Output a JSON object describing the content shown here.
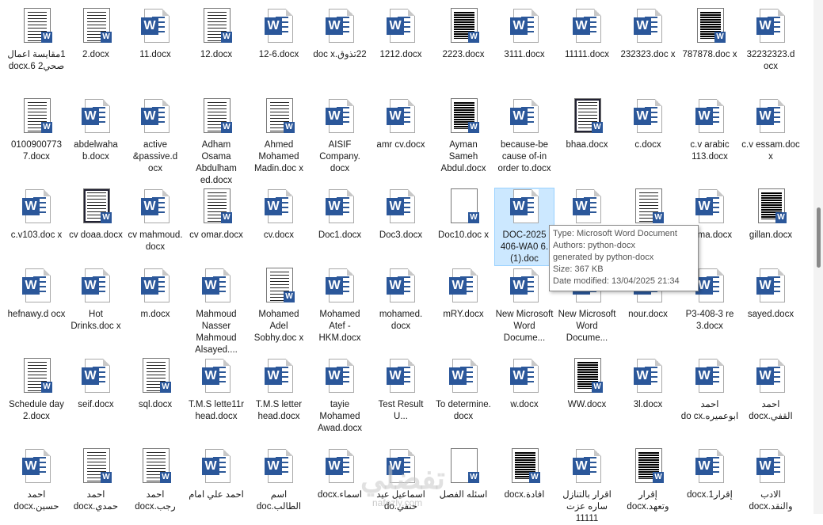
{
  "items": [
    {
      "label": "1مقايسة اعمال صحي2 6.docx",
      "kind": "thumb"
    },
    {
      "label": "2.docx",
      "kind": "thumb"
    },
    {
      "label": "11.docx",
      "kind": "word"
    },
    {
      "label": "12.docx",
      "kind": "thumb"
    },
    {
      "label": "12-6.docx",
      "kind": "word"
    },
    {
      "label": "22تذوق.doc x",
      "kind": "word"
    },
    {
      "label": "1212.docx",
      "kind": "word"
    },
    {
      "label": "2223.docx",
      "kind": "thumb-dark"
    },
    {
      "label": "3111.docx",
      "kind": "word"
    },
    {
      "label": "11111.docx",
      "kind": "word"
    },
    {
      "label": "232323.doc x",
      "kind": "word"
    },
    {
      "label": "787878.doc x",
      "kind": "thumb-dark"
    },
    {
      "label": "32232323.d ocx",
      "kind": "word"
    },
    {
      "label": "0100900773 7.docx",
      "kind": "thumb"
    },
    {
      "label": "abdelwaha b.docx",
      "kind": "word"
    },
    {
      "label": "active &passive.d ocx",
      "kind": "word"
    },
    {
      "label": "Adham Osama Abdulham ed.docx",
      "kind": "thumb"
    },
    {
      "label": "Ahmed Mohamed Madin.doc x",
      "kind": "thumb"
    },
    {
      "label": "AISIF Company. docx",
      "kind": "word"
    },
    {
      "label": "amr cv.docx",
      "kind": "word"
    },
    {
      "label": "Ayman Sameh Abdul.docx",
      "kind": "thumb-dark"
    },
    {
      "label": "because-be cause of-in order to.docx",
      "kind": "word"
    },
    {
      "label": "bhaa.docx",
      "kind": "thumb-border"
    },
    {
      "label": "c.docx",
      "kind": "word"
    },
    {
      "label": "c.v arabic 113.docx",
      "kind": "word"
    },
    {
      "label": "c.v essam.doc x",
      "kind": "word"
    },
    {
      "label": "c.v103.doc x",
      "kind": "word"
    },
    {
      "label": "cv doaa.docx",
      "kind": "thumb-border"
    },
    {
      "label": "cv mahmoud. docx",
      "kind": "word"
    },
    {
      "label": "cv omar.docx",
      "kind": "thumb"
    },
    {
      "label": "cv.docx",
      "kind": "word"
    },
    {
      "label": "Doc1.docx",
      "kind": "word"
    },
    {
      "label": "Doc3.docx",
      "kind": "word"
    },
    {
      "label": "Doc10.doc x",
      "kind": "thumb-blank"
    },
    {
      "label": "DOC-2025 406-WA0 6.(1).doc",
      "kind": "selected"
    },
    {
      "label": "",
      "kind": "word"
    },
    {
      "label": "",
      "kind": "thumb"
    },
    {
      "label": "fatma.docx",
      "kind": "word"
    },
    {
      "label": "gillan.docx",
      "kind": "thumb-dark"
    },
    {
      "label": "hefnawy.d ocx",
      "kind": "word"
    },
    {
      "label": "Hot Drinks.doc x",
      "kind": "word"
    },
    {
      "label": "m.docx",
      "kind": "word"
    },
    {
      "label": "Mahmoud Nasser Mahmoud Alsayed....",
      "kind": "word"
    },
    {
      "label": "Mohamed Adel Sobhy.doc x",
      "kind": "thumb"
    },
    {
      "label": "Mohamed Atef - HKM.docx",
      "kind": "word"
    },
    {
      "label": "mohamed. docx",
      "kind": "word"
    },
    {
      "label": "mRY.docx",
      "kind": "word"
    },
    {
      "label": "New Microsoft Word Docume...",
      "kind": "word"
    },
    {
      "label": "New Microsoft Word Docume...",
      "kind": "word"
    },
    {
      "label": "nour.docx",
      "kind": "word"
    },
    {
      "label": "P3-408-3 re 3.docx",
      "kind": "word"
    },
    {
      "label": "sayed.docx",
      "kind": "word"
    },
    {
      "label": "Schedule day 2.docx",
      "kind": "thumb"
    },
    {
      "label": "seif.docx",
      "kind": "word"
    },
    {
      "label": "sql.docx",
      "kind": "thumb"
    },
    {
      "label": "T.M.S lette11r head.docx",
      "kind": "word"
    },
    {
      "label": "T.M.S letter head.docx",
      "kind": "word"
    },
    {
      "label": "tayie Mohamed Awad.docx",
      "kind": "word"
    },
    {
      "label": "Test Result U...",
      "kind": "word"
    },
    {
      "label": "To determine. docx",
      "kind": "word"
    },
    {
      "label": "w.docx",
      "kind": "word"
    },
    {
      "label": "WW.docx",
      "kind": "thumb-dark"
    },
    {
      "label": "3l.docx",
      "kind": "word"
    },
    {
      "label": "احمد ابوعميره.do cx",
      "kind": "word"
    },
    {
      "label": "احمد القفي.docx",
      "kind": "word"
    },
    {
      "label": "احمد حسين.docx",
      "kind": "word"
    },
    {
      "label": "احمد حمدي.docx",
      "kind": "thumb"
    },
    {
      "label": "احمد رجب.docx",
      "kind": "thumb"
    },
    {
      "label": "احمد علي امام",
      "kind": "word"
    },
    {
      "label": "اسم الطالب.doc",
      "kind": "word"
    },
    {
      "label": "اسماء.docx",
      "kind": "word"
    },
    {
      "label": "اسماعيل عيد حنفي.do",
      "kind": "word"
    },
    {
      "label": "اسئله الفصل",
      "kind": "thumb-blank"
    },
    {
      "label": "افادة.docx",
      "kind": "thumb-dark"
    },
    {
      "label": "اقرار بالتنازل ساره عزت 11111",
      "kind": "word"
    },
    {
      "label": "إقرار وتعهد.docx",
      "kind": "thumb-dark"
    },
    {
      "label": "إقرار1.docx",
      "kind": "word"
    },
    {
      "label": "الادب والنقد.docx",
      "kind": "word"
    }
  ],
  "tooltip": {
    "type": "Type: Microsoft Word Document",
    "authors": "Authors: python-docx",
    "generated": "generated by python-docx",
    "size": "Size: 367 KB",
    "modified": "Date modified: 13/04/2025 21:34"
  },
  "watermark": "تفضلي",
  "watermark_url": "nafezly.com",
  "colors": {
    "word_blue": "#2b579a",
    "selection": "#cce8ff"
  }
}
